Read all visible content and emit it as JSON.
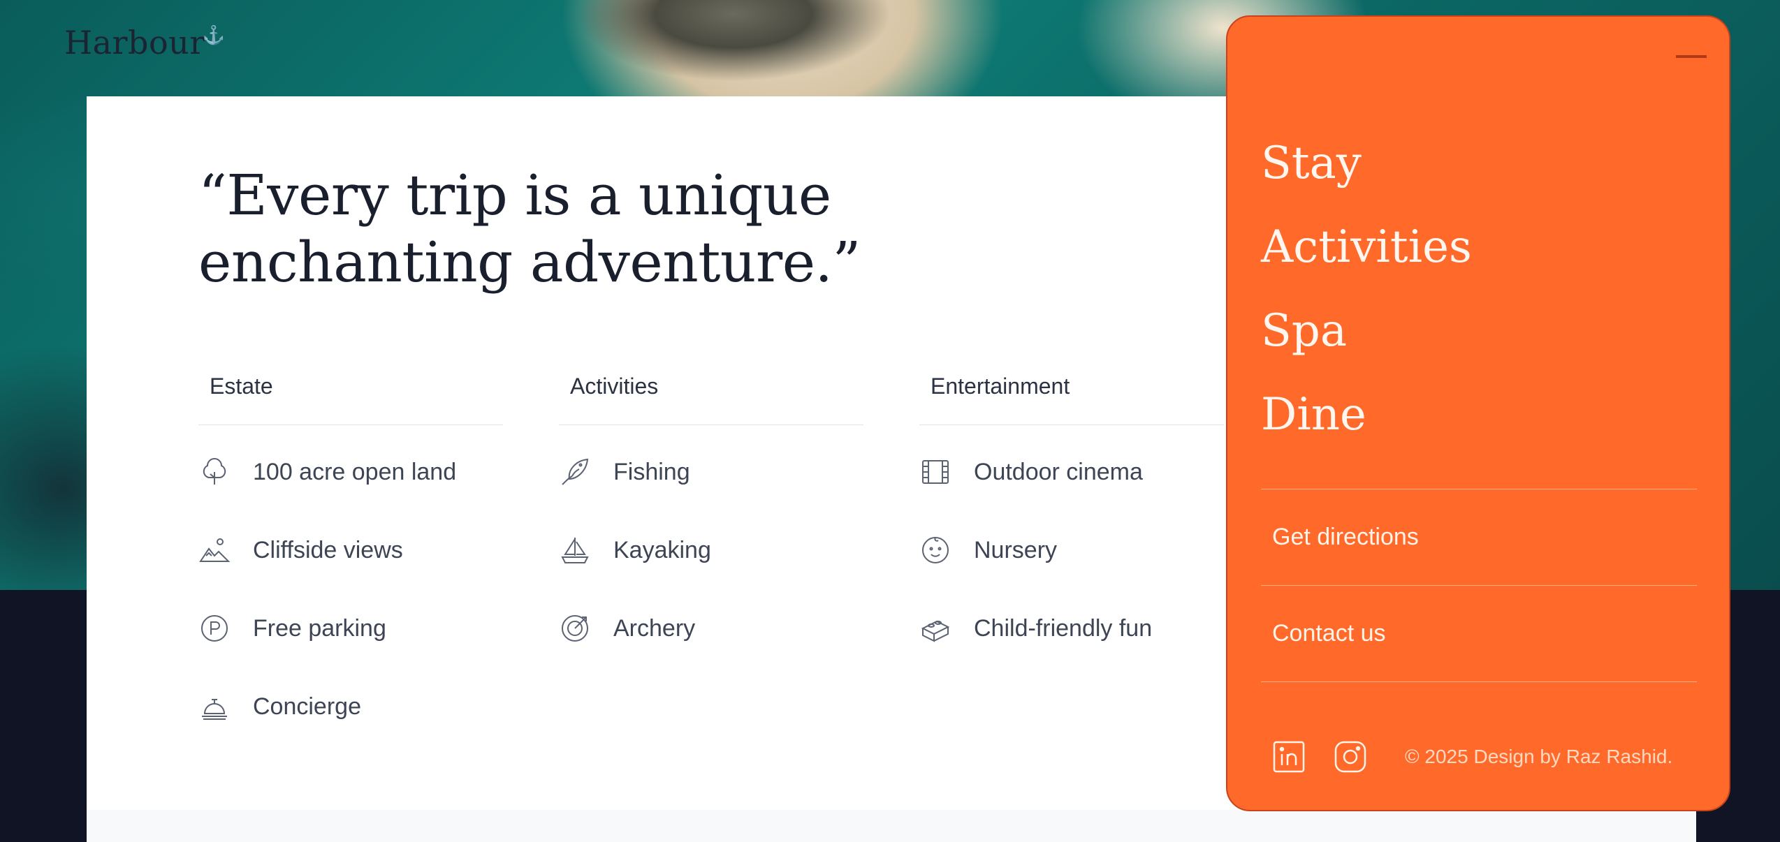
{
  "brand": {
    "name": "Harbour",
    "mark": "⚓"
  },
  "quote": {
    "line1": "“Every trip is a unique",
    "line2": "enchanting adventure.”"
  },
  "columns": [
    {
      "heading": "Estate",
      "items": [
        {
          "label": "100 acre open land",
          "icon": "tree-icon"
        },
        {
          "label": "Cliffside views",
          "icon": "mountain-icon"
        },
        {
          "label": "Free parking",
          "icon": "parking-icon"
        },
        {
          "label": "Concierge",
          "icon": "bell-icon"
        }
      ]
    },
    {
      "heading": "Activities",
      "items": [
        {
          "label": "Fishing",
          "icon": "leaf-fish-icon"
        },
        {
          "label": "Kayaking",
          "icon": "sailboat-icon"
        },
        {
          "label": "Archery",
          "icon": "target-icon"
        }
      ]
    },
    {
      "heading": "Entertainment",
      "items": [
        {
          "label": "Outdoor cinema",
          "icon": "film-icon"
        },
        {
          "label": "Nursery",
          "icon": "baby-face-icon"
        },
        {
          "label": "Child-friendly fun",
          "icon": "toy-brick-icon"
        }
      ]
    }
  ],
  "menu": {
    "nav": [
      "Stay",
      "Activities",
      "Spa",
      "Dine"
    ],
    "links": [
      "Get directions",
      "Contact us"
    ],
    "social": [
      "linkedin-icon",
      "instagram-icon"
    ],
    "copyright": "© 2025 Design by Raz Rashid."
  },
  "colors": {
    "accent": "#ff6a2b",
    "ink": "#1a1f2e",
    "muted_text": "#3d4453",
    "dark_band": "#111425"
  }
}
